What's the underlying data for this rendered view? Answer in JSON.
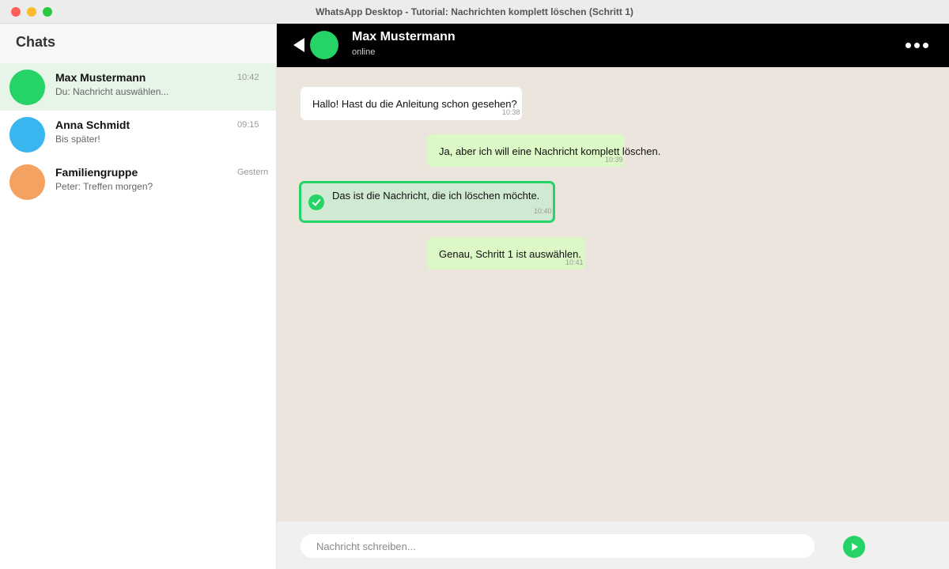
{
  "window": {
    "title": "WhatsApp Desktop - Tutorial: Nachrichten komplett löschen (Schritt 1)"
  },
  "sidebar": {
    "title": "Chats",
    "chats": [
      {
        "name": "Max Mustermann",
        "preview": "Du: Nachricht auswählen...",
        "time": "10:42",
        "avatar_color": "#25d366",
        "active": true
      },
      {
        "name": "Anna Schmidt",
        "preview": "Bis später!",
        "time": "09:15",
        "avatar_color": "#39b6f0",
        "active": false
      },
      {
        "name": "Familiengruppe",
        "preview": "Peter: Treffen morgen?",
        "time": "Gestern",
        "avatar_color": "#f4a261",
        "active": false
      }
    ]
  },
  "chat": {
    "contact_name": "Max Mustermann",
    "status": "online",
    "back_icon": "back-arrow-icon",
    "menu_icon": "more-dots-icon",
    "messages": [
      {
        "direction": "incoming",
        "text": "Hallo! Hast du die Anleitung schon gesehen?",
        "time": "10:38",
        "selected": false
      },
      {
        "direction": "outgoing",
        "text": "Ja, aber ich will eine Nachricht komplett löschen.",
        "time": "10:39",
        "selected": false
      },
      {
        "direction": "outgoing",
        "text": "Das ist die Nachricht, die ich löschen möchte.",
        "time": "10:40",
        "selected": true
      },
      {
        "direction": "outgoing",
        "text": "Genau, Schritt 1 ist auswählen.",
        "time": "10:41",
        "selected": false
      }
    ],
    "input_placeholder": "Nachricht schreiben...",
    "input_value": "",
    "send_icon": "send-icon"
  },
  "colors": {
    "accent": "#25d366",
    "chat_background": "#ece5dd",
    "outgoing_bubble": "#dcf8c6",
    "selected_bubble": "#cfe9d3",
    "header": "#000000"
  }
}
